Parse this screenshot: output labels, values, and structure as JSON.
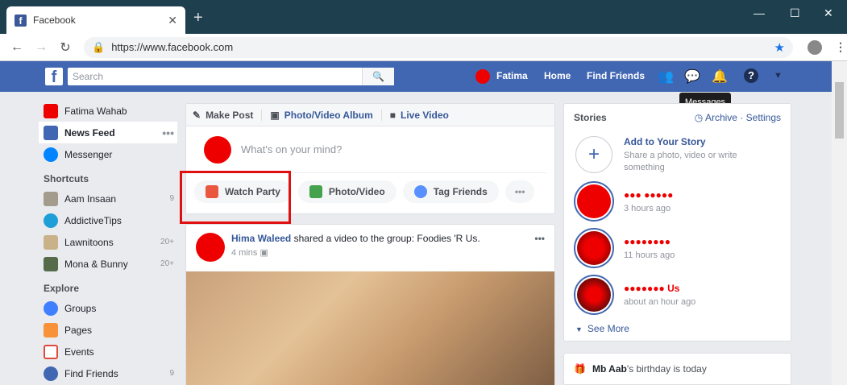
{
  "browser": {
    "tab_title": "Facebook",
    "url": "https://www.facebook.com",
    "new_tab": "+",
    "close_tab": "✕"
  },
  "fb_header": {
    "search_placeholder": "Search",
    "user_name": "Fatima",
    "home": "Home",
    "find_friends": "Find Friends",
    "tooltip": "Messages"
  },
  "left_nav": {
    "profile_name": "Fatima Wahab",
    "items": [
      {
        "label": "News Feed"
      },
      {
        "label": "Messenger"
      }
    ],
    "shortcuts_header": "Shortcuts",
    "shortcuts": [
      {
        "label": "Aam Insaan",
        "count": "9"
      },
      {
        "label": "AddictiveTips",
        "count": ""
      },
      {
        "label": "Lawnitoons",
        "count": "20+"
      },
      {
        "label": "Mona & Bunny",
        "count": "20+"
      }
    ],
    "explore_header": "Explore",
    "explore": [
      {
        "label": "Groups",
        "count": ""
      },
      {
        "label": "Pages",
        "count": ""
      },
      {
        "label": "Events",
        "count": ""
      },
      {
        "label": "Find Friends",
        "count": "9"
      }
    ]
  },
  "composer": {
    "tab_make_post": "Make Post",
    "tab_album": "Photo/Video Album",
    "tab_live": "Live Video",
    "placeholder": "What's on your mind?",
    "watch_party": "Watch Party",
    "photo_video": "Photo/Video",
    "tag_friends": "Tag Friends",
    "more": "•••"
  },
  "post": {
    "author": "Hima Waleed",
    "action": "shared a video to the group: Foodies 'R Us.",
    "time": "4 mins"
  },
  "stories": {
    "title": "Stories",
    "archive": "Archive",
    "settings": "Settings",
    "add_title": "Add to Your Story",
    "add_sub": "Share a photo, video or write something",
    "items": [
      {
        "name": "●●● ●●●●●",
        "time": "3 hours ago"
      },
      {
        "name": "●●●●●●●●",
        "time": "11 hours ago"
      },
      {
        "name": "●●●●●●● Us",
        "time": "about an hour ago"
      }
    ],
    "see_more": "See More"
  },
  "birthday": {
    "name": "Mb Aab",
    "text": "'s birthday is today"
  }
}
